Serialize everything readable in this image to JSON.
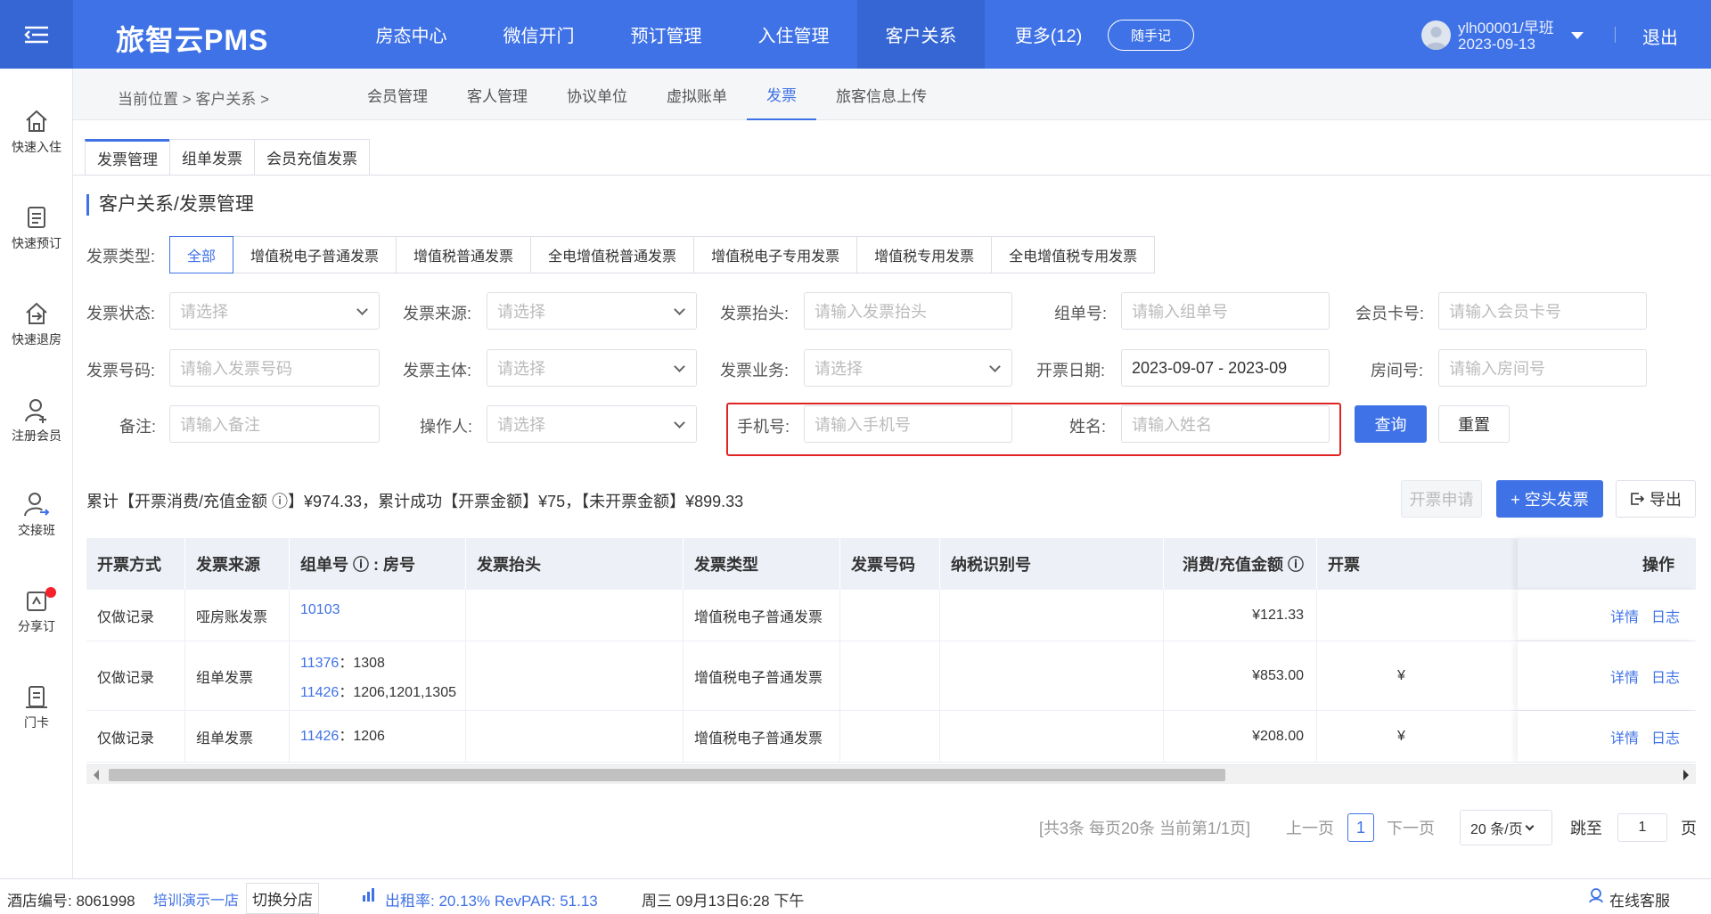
{
  "app": {
    "title": "旅智云PMS"
  },
  "topnav": {
    "items": [
      "房态中心",
      "微信开门",
      "预订管理",
      "入住管理",
      "客户关系",
      "更多(12)"
    ],
    "active_index": 4,
    "note_label": "随手记"
  },
  "user": {
    "name": "ylh00001/早班",
    "date": "2023-09-13",
    "logout": "退出"
  },
  "sidebar": {
    "items": [
      "快速入住",
      "快速预订",
      "快速退房",
      "注册会员",
      "交接班",
      "分享订",
      "门卡"
    ]
  },
  "breadcrumb": "当前位置 > 客户关系 >",
  "subnav": {
    "items": [
      "会员管理",
      "客人管理",
      "协议单位",
      "虚拟账单",
      "发票",
      "旅客信息上传"
    ],
    "active_index": 4
  },
  "tabs": {
    "items": [
      "发票管理",
      "组单发票",
      "会员充值发票"
    ],
    "active_index": 0
  },
  "section_title": "客户关系/发票管理",
  "filters": {
    "type_label": "发票类型:",
    "types": [
      "全部",
      "增值税电子普通发票",
      "增值税普通发票",
      "全电增值税普通发票",
      "增值税电子专用发票",
      "增值税专用发票",
      "全电增值税专用发票"
    ],
    "status_label": "发票状态:",
    "status_placeholder": "请选择",
    "source_label": "发票来源:",
    "source_placeholder": "请选择",
    "title_label": "发票抬头:",
    "title_placeholder": "请输入发票抬头",
    "group_label": "组单号:",
    "group_placeholder": "请输入组单号",
    "member_label": "会员卡号:",
    "member_placeholder": "请输入会员卡号",
    "number_label": "发票号码:",
    "number_placeholder": "请输入发票号码",
    "subject_label": "发票主体:",
    "subject_placeholder": "请选择",
    "business_label": "发票业务:",
    "business_placeholder": "请选择",
    "date_label": "开票日期:",
    "date_value": "2023-09-07 - 2023-09",
    "room_label": "房间号:",
    "room_placeholder": "请输入房间号",
    "remark_label": "备注:",
    "remark_placeholder": "请输入备注",
    "operator_label": "操作人:",
    "operator_placeholder": "请选择",
    "phone_label": "手机号:",
    "phone_placeholder": "请输入手机号",
    "name_label": "姓名:",
    "name_placeholder": "请输入姓名",
    "query": "查询",
    "reset": "重置"
  },
  "summary": "累计【开票消费/充值金额 ⓘ】¥974.33，累计成功【开票金额】¥75，【未开票金额】¥899.33",
  "actions": {
    "apply": "开票申请",
    "blank": "+ 空头发票",
    "export": "导出"
  },
  "table": {
    "headers": [
      "开票方式",
      "发票来源",
      "组单号 ⓘ : 房号",
      "发票抬头",
      "发票类型",
      "发票号码",
      "纳税识别号",
      "消费/充值金额 ⓘ",
      "开票",
      "操作"
    ],
    "rows": [
      {
        "method": "仅做记录",
        "source": "哑房账发票",
        "groups": [
          {
            "id": "10103",
            "room": ""
          }
        ],
        "type": "增值税电子普通发票",
        "amount": "¥121.33",
        "invoiced": ""
      },
      {
        "method": "仅做记录",
        "source": "组单发票",
        "groups": [
          {
            "id": "11376",
            "room": "1308"
          },
          {
            "id": "11426",
            "room": "1206,1201,1305"
          }
        ],
        "type": "增值税电子普通发票",
        "amount": "¥853.00",
        "invoiced": "¥"
      },
      {
        "method": "仅做记录",
        "source": "组单发票",
        "groups": [
          {
            "id": "11426",
            "room": "1206"
          }
        ],
        "type": "增值税电子普通发票",
        "amount": "¥208.00",
        "invoiced": "¥"
      }
    ],
    "op_detail": "详情",
    "op_log": "日志"
  },
  "pagination": {
    "info": "[共3条 每页20条 当前第1/1页]",
    "prev": "上一页",
    "current": "1",
    "next": "下一页",
    "size": "20 条/页",
    "jump": "跳至",
    "jump_value": "1",
    "page_unit": "页"
  },
  "footer": {
    "hotel_code": "酒店编号: 8061998",
    "hotel_name": "培训演示一店",
    "switch": "切换分店",
    "stats": "出租率: 20.13% RevPAR: 51.13",
    "datetime": "周三 09月13日6:28 下午",
    "service": "在线客服"
  }
}
